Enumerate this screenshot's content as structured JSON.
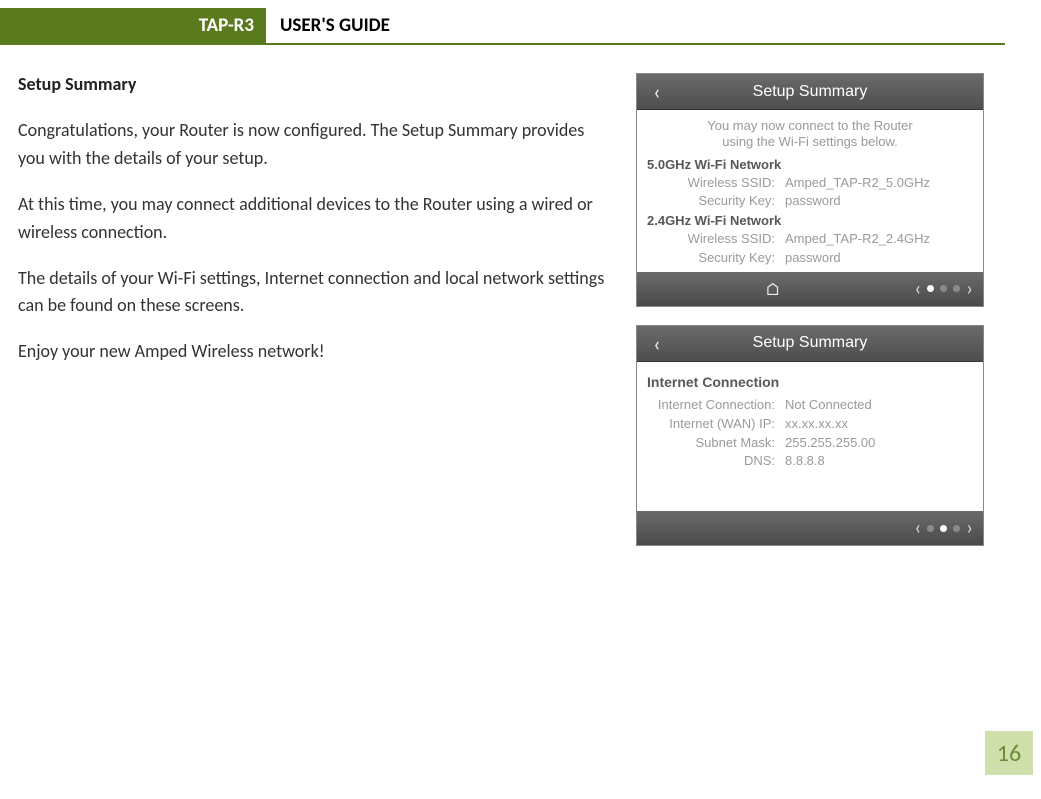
{
  "header": {
    "tab": "TAP-R3",
    "title": "USER'S GUIDE"
  },
  "section_title": "Setup Summary",
  "paragraphs": {
    "p1": "Congratulations, your Router is now configured.  The Setup Summary provides you with the details of your setup.",
    "p2": "At this time, you may connect additional devices to the Router using a wired or wireless connection.",
    "p3": "The details of your Wi-Fi settings, Internet connection and local network settings can be found on these screens.",
    "p4": "Enjoy your new Amped Wireless network!"
  },
  "screen1": {
    "title": "Setup Summary",
    "helper1": "You may now connect to the Router",
    "helper2": "using the Wi-Fi settings below.",
    "band5_heading": "5.0GHz Wi-Fi Network",
    "ssid_label": "Wireless SSID:",
    "key_label": "Security Key:",
    "band5_ssid": "Amped_TAP-R2_5.0GHz",
    "band5_key": "password",
    "band24_heading": "2.4GHz Wi-Fi Network",
    "band24_ssid": "Amped_TAP-R2_2.4GHz",
    "band24_key": "password"
  },
  "screen2": {
    "title": "Setup Summary",
    "heading": "Internet Connection",
    "conn_label": "Internet Connection:",
    "conn_value": "Not Connected",
    "wan_label": "Internet (WAN) IP:",
    "wan_value": "xx.xx.xx.xx",
    "mask_label": "Subnet Mask:",
    "mask_value": "255.255.255.00",
    "dns_label": "DNS:",
    "dns_value": "8.8.8.8"
  },
  "page_number": "16"
}
